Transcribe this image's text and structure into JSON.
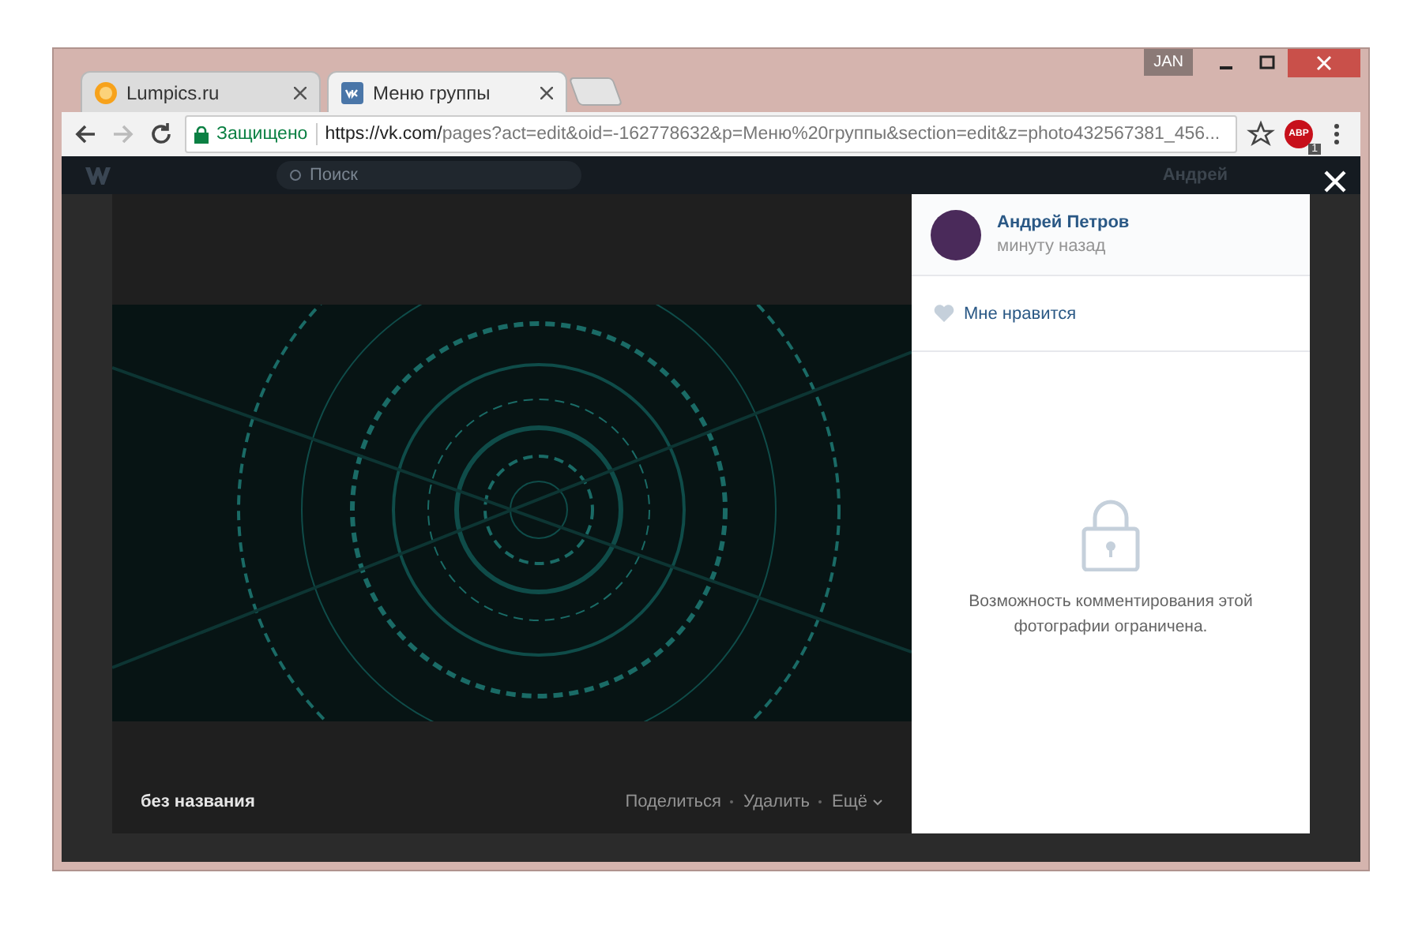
{
  "browser": {
    "badge": "JAN",
    "tabs": [
      {
        "title": "Lumpics.ru",
        "selected": false
      },
      {
        "title": "Меню группы",
        "selected": true
      }
    ],
    "security_label": "Защищено",
    "url_host": "https://vk.com/",
    "url_path": "pages?act=edit&oid=-162778632&p=Меню%20группы&section=edit&z=photo432567381_456...",
    "extension": {
      "label": "ABP",
      "count": "1"
    }
  },
  "site_header": {
    "search_placeholder": "Поиск",
    "user_name": "Андрей"
  },
  "photo_viewer": {
    "caption": "без названия",
    "actions": [
      {
        "label": "Поделиться",
        "kind": "link"
      },
      {
        "label": "Удалить",
        "kind": "link"
      },
      {
        "label": "Ещё",
        "kind": "menu"
      }
    ]
  },
  "post": {
    "author": "Андрей Петров",
    "time": "минуту назад",
    "like_label": "Мне нравится",
    "liked": false,
    "comments_notice": "Возможность комментирования этой фотографии ограничена."
  }
}
